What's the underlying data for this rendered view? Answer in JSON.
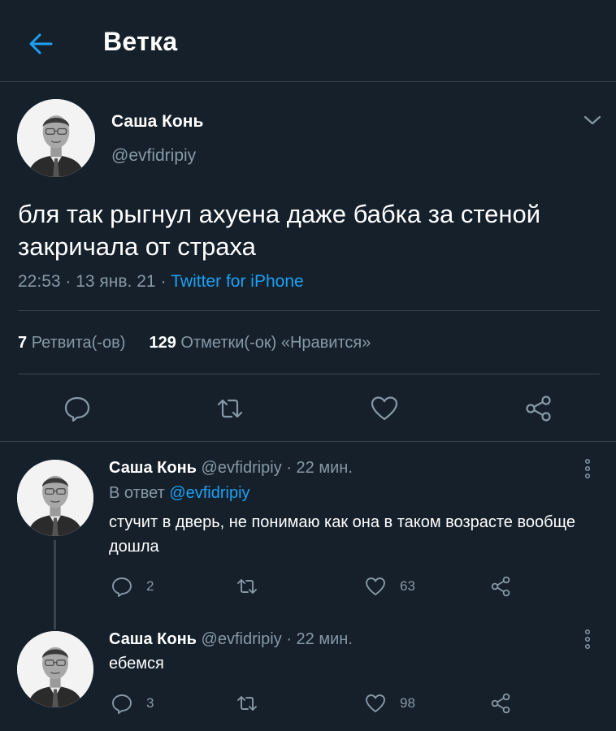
{
  "header": {
    "title": "Ветка",
    "back_icon": "arrow-left-icon"
  },
  "main_tweet": {
    "name": "Саша Конь",
    "handle": "@evfidripiy",
    "text": "бля так рыгнул ахуена даже бабка за стеной закричала от страха",
    "time": "22:53",
    "date": "13 янв. 21",
    "source": "Twitter for iPhone",
    "retweets_count": "7",
    "retweets_label": "Ретвита(-ов)",
    "likes_count": "129",
    "likes_label": "Отметки(-ок) «Нравится»"
  },
  "replies": [
    {
      "name": "Саша Конь",
      "handle": "@evfidripiy",
      "time": "22 мин.",
      "reply_prefix": "В ответ",
      "reply_to": "@evfidripiy",
      "text": "стучит в дверь, не понимаю как она в таком возрасте вообще дошла",
      "replies_count": "2",
      "retweets_count": "",
      "likes_count": "63"
    },
    {
      "name": "Саша Конь",
      "handle": "@evfidripiy",
      "time": "22 мин.",
      "text": "ебемся",
      "replies_count": "3",
      "retweets_count": "",
      "likes_count": "98"
    }
  ],
  "colors": {
    "background": "#15202b",
    "accent": "#1da1f2",
    "muted": "#8899a6",
    "divider": "#38444d"
  }
}
